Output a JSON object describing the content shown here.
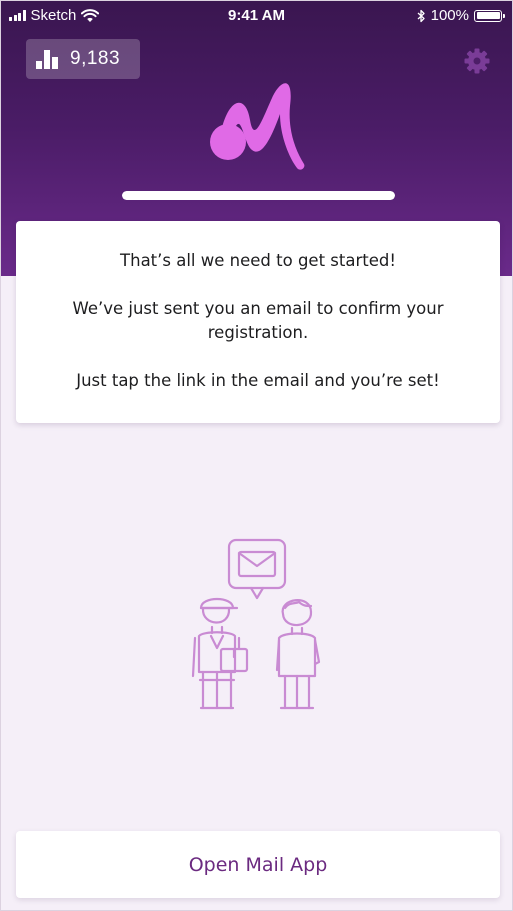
{
  "status_bar": {
    "carrier": "Sketch",
    "time": "9:41 AM",
    "battery_percent": "100%",
    "icons": [
      "signal-icon",
      "wifi-icon",
      "bluetooth-icon",
      "battery-icon"
    ]
  },
  "header": {
    "score_value": "9,183",
    "score_icon": "bar-chart-icon",
    "settings_icon": "gear-icon",
    "logo": "app-logo",
    "progress_fraction": 1.0
  },
  "info_card": {
    "line1": "That’s all we need to get started!",
    "line2": "We’ve just sent you an email to confirm your registration.",
    "line3": "Just tap the link in the email and you’re set!"
  },
  "illustration": "mail-delivery-illustration",
  "actions": {
    "open_mail_label": "Open Mail App"
  },
  "colors": {
    "header_top": "#3a1650",
    "header_bottom": "#6a2a8a",
    "logo_accent": "#e06ae6",
    "page_background": "#f5eff8",
    "button_text": "#6b2a80",
    "illustration_stroke": "#c98bd3"
  }
}
